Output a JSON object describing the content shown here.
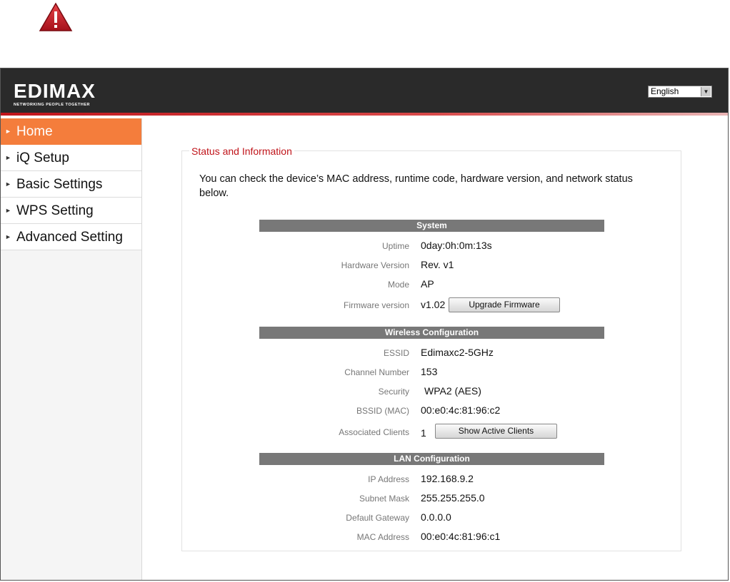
{
  "header": {
    "logo_text": "EDIMAX",
    "logo_tagline": "NETWORKING PEOPLE TOGETHER",
    "language_selected": "English"
  },
  "sidebar": {
    "items": [
      {
        "label": "Home",
        "active": true
      },
      {
        "label": "iQ Setup",
        "active": false
      },
      {
        "label": "Basic Settings",
        "active": false
      },
      {
        "label": "WPS Setting",
        "active": false
      },
      {
        "label": "Advanced Setting",
        "active": false
      }
    ]
  },
  "main": {
    "panel_title": "Status and Information",
    "description": "You can check the device’s MAC address, runtime code, hardware version, and network status below.",
    "system": {
      "header": "System",
      "uptime_label": "Uptime",
      "uptime_value": "0day:0h:0m:13s",
      "hw_label": "Hardware Version",
      "hw_value": "Rev. v1",
      "mode_label": "Mode",
      "mode_value": "AP",
      "fw_label": "Firmware version",
      "fw_value": "v1.02",
      "upgrade_button": "Upgrade Firmware"
    },
    "wireless": {
      "header": "Wireless Configuration",
      "essid_label": "ESSID",
      "essid_value": "Edimaxc2-5GHz",
      "channel_label": "Channel Number",
      "channel_value": "153",
      "security_label": "Security",
      "security_value": "WPA2 (AES)",
      "bssid_label": "BSSID (MAC)",
      "bssid_value": "00:e0:4c:81:96:c2",
      "clients_label": "Associated Clients",
      "clients_value": "1",
      "clients_button": "Show Active Clients"
    },
    "lan": {
      "header": "LAN Configuration",
      "ip_label": "IP Address",
      "ip_value": "192.168.9.2",
      "subnet_label": "Subnet Mask",
      "subnet_value": "255.255.255.0",
      "gateway_label": "Default Gateway",
      "gateway_value": "0.0.0.0",
      "mac_label": "MAC Address",
      "mac_value": "00:e0:4c:81:96:c1"
    }
  },
  "colors": {
    "accent_orange": "#f47d3c",
    "header_dark": "#2a2a2a",
    "brand_red": "#c0141a",
    "section_bar": "#787878"
  },
  "icons": {
    "warning": "warning-icon",
    "dropdown": "chevron-down-icon",
    "nav_arrow": "triangle-right-icon"
  }
}
